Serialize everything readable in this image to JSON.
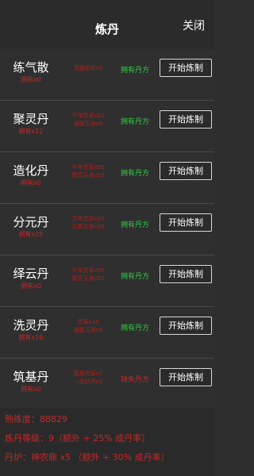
{
  "header": {
    "title": "炼丹",
    "close_label": "关闭"
  },
  "pills": [
    {
      "name": "练气散",
      "owned": "拥有x0",
      "materials": [
        "灵露花草x2"
      ],
      "recipe": "拥有丹方",
      "recipe_status": "owned",
      "button": "开始炼制"
    },
    {
      "name": "聚灵丹",
      "owned": "拥有x12",
      "materials": [
        "千年灵草x20",
        "凝露玉液x8"
      ],
      "recipe": "拥有丹方",
      "recipe_status": "owned",
      "button": "开始炼制"
    },
    {
      "name": "造化丹",
      "owned": "拥有x0",
      "materials": [
        "千年灵草x50",
        "聚灵玉液x15"
      ],
      "recipe": "拥有丹方",
      "recipe_status": "owned",
      "button": "开始炼制"
    },
    {
      "name": "分元丹",
      "owned": "拥有x25",
      "materials": [
        "万年灵草x20",
        "元婴玉液x25"
      ],
      "recipe": "拥有丹方",
      "recipe_status": "owned",
      "button": "开始炼制"
    },
    {
      "name": "绎云丹",
      "owned": "拥有x0",
      "materials": [
        "千年灵草x50",
        "聚灵玉液x20"
      ],
      "recipe": "拥有丹方",
      "recipe_status": "owned",
      "button": "开始炼制"
    },
    {
      "name": "洗灵丹",
      "owned": "拥有x10",
      "materials": [
        "灵果x10",
        "凝露玉液x8"
      ],
      "recipe": "拥有丹方",
      "recipe_status": "owned",
      "button": "开始炼制"
    },
    {
      "name": "筑基丹",
      "owned": "拥有x0",
      "materials": [
        "蓬莱灵草x7",
        "一品妖丹x1"
      ],
      "recipe": "缺失丹方",
      "recipe_status": "missing",
      "button": "开始炼制"
    }
  ],
  "stats": {
    "proficiency": "熟练度：88829",
    "level": "炼丹等级：9（额外 + 25% 成丹率）",
    "furnace": "丹炉：神农鼎 x5 （额外 + 30% 成丹率）"
  },
  "colors": {
    "background": "#2e2e2e",
    "stat_red": "#c62828",
    "recipe_green": "#2ecc40"
  }
}
